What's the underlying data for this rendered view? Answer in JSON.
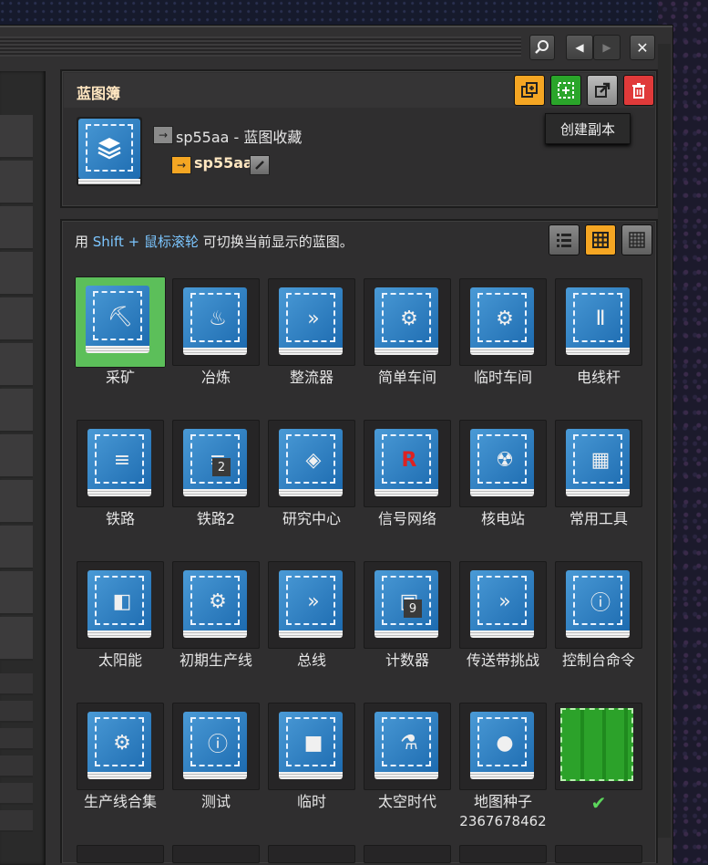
{
  "window": {
    "search_icon": "search-icon",
    "prev_icon": "◀",
    "next_icon": "▶",
    "close_icon": "✕"
  },
  "book_panel": {
    "title": "蓝图簿",
    "tooltip": "创建副本",
    "book_name": "sp55aa - 蓝图收藏",
    "author": "sp55aa",
    "buttons": [
      {
        "name": "copy",
        "color": "#f5a623"
      },
      {
        "name": "select",
        "color": "#2aa52a"
      },
      {
        "name": "export",
        "color": "#8a8a8a"
      },
      {
        "name": "delete",
        "color": "#e03a3a"
      }
    ]
  },
  "grid_panel": {
    "hint_prefix": "用 ",
    "hint_key": "Shift + 鼠标滚轮",
    "hint_suffix": " 可切换当前显示的蓝图。",
    "view_modes": [
      "list",
      "grid",
      "small-grid"
    ],
    "active_view": "grid"
  },
  "blueprints": [
    {
      "label": "采矿",
      "icon": "mining-drill-icon",
      "glyph": "⛏",
      "selected": true
    },
    {
      "label": "冶炼",
      "icon": "furnace-icon",
      "glyph": "♨"
    },
    {
      "label": "整流器",
      "icon": "belt-icon",
      "glyph": "»"
    },
    {
      "label": "简单车间",
      "icon": "assembler-icon",
      "glyph": "⚙"
    },
    {
      "label": "临时车间",
      "icon": "assembler-icon",
      "glyph": "⚙"
    },
    {
      "label": "电线杆",
      "icon": "power-pole-icon",
      "glyph": "Ⅱ"
    },
    {
      "label": "铁路",
      "icon": "rail-icon",
      "glyph": "≡"
    },
    {
      "label": "铁路2",
      "icon": "rail-icon",
      "glyph": "≡",
      "badge": "2"
    },
    {
      "label": "研究中心",
      "icon": "lab-icon",
      "glyph": "◈"
    },
    {
      "label": "信号网络",
      "icon": "signal-icon",
      "glyph": "R"
    },
    {
      "label": "核电站",
      "icon": "reactor-icon",
      "glyph": "☢"
    },
    {
      "label": "常用工具",
      "icon": "tools-icon",
      "glyph": "▦"
    },
    {
      "label": "太阳能",
      "icon": "solar-panel-icon",
      "glyph": "◧"
    },
    {
      "label": "初期生产线",
      "icon": "assembler-icon",
      "glyph": "⚙"
    },
    {
      "label": "总线",
      "icon": "belt-icon",
      "glyph": "»"
    },
    {
      "label": "计数器",
      "icon": "combinator-icon",
      "glyph": "▣",
      "badge": "9"
    },
    {
      "label": "传送带挑战",
      "icon": "belt-icon",
      "glyph": "»"
    },
    {
      "label": "控制台命令",
      "icon": "info-icon",
      "glyph": "ⓘ"
    },
    {
      "label": "生产线合集",
      "icon": "assembler-icon",
      "glyph": "⚙"
    },
    {
      "label": "测试",
      "icon": "info-icon",
      "glyph": "ⓘ"
    },
    {
      "label": "临时",
      "icon": "square-icon",
      "glyph": "■"
    },
    {
      "label": "太空时代",
      "icon": "space-icon",
      "glyph": "⚗"
    },
    {
      "label": "地图种子",
      "icon": "planet-icon",
      "glyph": "●",
      "sublabel": "2367678462"
    },
    {
      "label": "",
      "icon": "checkmark-icon",
      "glyph": "✔",
      "empty": true
    }
  ]
}
